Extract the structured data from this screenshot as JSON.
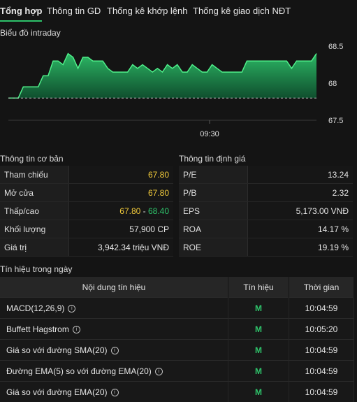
{
  "tabs": [
    {
      "label": "Tổng hợp",
      "active": true
    },
    {
      "label": "Thông tin GD",
      "active": false
    },
    {
      "label": "Thống kê khớp lệnh",
      "active": false
    },
    {
      "label": "Thống kê giao dịch NĐT",
      "active": false
    }
  ],
  "chart_section_title": "Biểu đồ intraday",
  "chart_data": {
    "type": "area",
    "title": "Biểu đồ intraday",
    "x_tick_labels": [
      "09:30"
    ],
    "y_tick_labels": [
      "68.5",
      "68",
      "67.5"
    ],
    "ylim": [
      67.5,
      68.5
    ],
    "reference": 67.8,
    "series": [
      {
        "color": "#2ec26a",
        "points": [
          [
            0,
            67.8
          ],
          [
            1,
            67.8
          ],
          [
            2,
            67.8
          ],
          [
            3,
            67.95
          ],
          [
            4,
            67.95
          ],
          [
            5,
            67.95
          ],
          [
            6,
            67.95
          ],
          [
            7,
            68.1
          ],
          [
            8,
            68.1
          ],
          [
            9,
            68.3
          ],
          [
            10,
            68.3
          ],
          [
            11,
            68.25
          ],
          [
            12,
            68.4
          ],
          [
            13,
            68.35
          ],
          [
            14,
            68.2
          ],
          [
            15,
            68.35
          ],
          [
            16,
            68.35
          ],
          [
            17,
            68.3
          ],
          [
            18,
            68.3
          ],
          [
            19,
            68.3
          ],
          [
            20,
            68.2
          ],
          [
            21,
            68.15
          ],
          [
            22,
            68.15
          ],
          [
            23,
            68.15
          ],
          [
            24,
            68.15
          ],
          [
            25,
            68.25
          ],
          [
            26,
            68.2
          ],
          [
            27,
            68.25
          ],
          [
            28,
            68.2
          ],
          [
            29,
            68.15
          ],
          [
            30,
            68.2
          ],
          [
            31,
            68.15
          ],
          [
            32,
            68.25
          ],
          [
            33,
            68.2
          ],
          [
            34,
            68.25
          ],
          [
            35,
            68.15
          ],
          [
            36,
            68.15
          ],
          [
            37,
            68.25
          ],
          [
            38,
            68.2
          ],
          [
            39,
            68.15
          ],
          [
            40,
            68.15
          ],
          [
            41,
            68.25
          ],
          [
            42,
            68.2
          ],
          [
            43,
            68.15
          ],
          [
            44,
            68.15
          ],
          [
            45,
            68.15
          ],
          [
            46,
            68.15
          ],
          [
            47,
            68.15
          ],
          [
            48,
            68.3
          ],
          [
            49,
            68.3
          ],
          [
            50,
            68.3
          ],
          [
            51,
            68.3
          ],
          [
            52,
            68.3
          ],
          [
            53,
            68.3
          ],
          [
            54,
            68.3
          ],
          [
            55,
            68.3
          ],
          [
            56,
            68.3
          ],
          [
            57,
            68.2
          ],
          [
            58,
            68.3
          ],
          [
            59,
            68.3
          ],
          [
            60,
            68.3
          ],
          [
            61,
            68.3
          ],
          [
            62,
            68.4
          ]
        ]
      }
    ]
  },
  "basic_info": {
    "title": "Thông tin cơ bản",
    "rows": [
      {
        "label": "Tham chiếu",
        "value": "67.80"
      },
      {
        "label": "Mở cửa",
        "value": "67.80"
      },
      {
        "label": "Thấp/cao",
        "low": "67.80",
        "sep": " - ",
        "high": "68.40"
      },
      {
        "label": "Khối lượng",
        "value": "57,900 CP"
      },
      {
        "label": "Giá trị",
        "value": "3,942.34 triệu VNĐ"
      }
    ]
  },
  "valuation": {
    "title": "Thông tin định giá",
    "rows": [
      {
        "label": "P/E",
        "value": "13.24"
      },
      {
        "label": "P/B",
        "value": "2.32"
      },
      {
        "label": "EPS",
        "value": "5,173.00 VNĐ"
      },
      {
        "label": "ROA",
        "value": "14.17 %"
      },
      {
        "label": "ROE",
        "value": "19.19 %"
      }
    ]
  },
  "signals": {
    "title": "Tín hiệu trong ngày",
    "headers": [
      "Nội dung tín hiệu",
      "Tín hiệu",
      "Thời gian"
    ],
    "info_glyph": "i",
    "rows": [
      {
        "name": "MACD(12,26,9)",
        "signal": "M",
        "time": "10:04:59"
      },
      {
        "name": "Buffett Hagstrom",
        "signal": "M",
        "time": "10:05:20"
      },
      {
        "name": "Giá so với đường SMA(20)",
        "signal": "M",
        "time": "10:04:59"
      },
      {
        "name": "Đường EMA(5) so với đường EMA(20)",
        "signal": "M",
        "time": "10:04:59"
      },
      {
        "name": "Giá so với đường EMA(20)",
        "signal": "M",
        "time": "10:04:59"
      }
    ]
  },
  "colors": {
    "up": "#2ec26a",
    "ref": "#f0c93a",
    "background": "#141414"
  }
}
